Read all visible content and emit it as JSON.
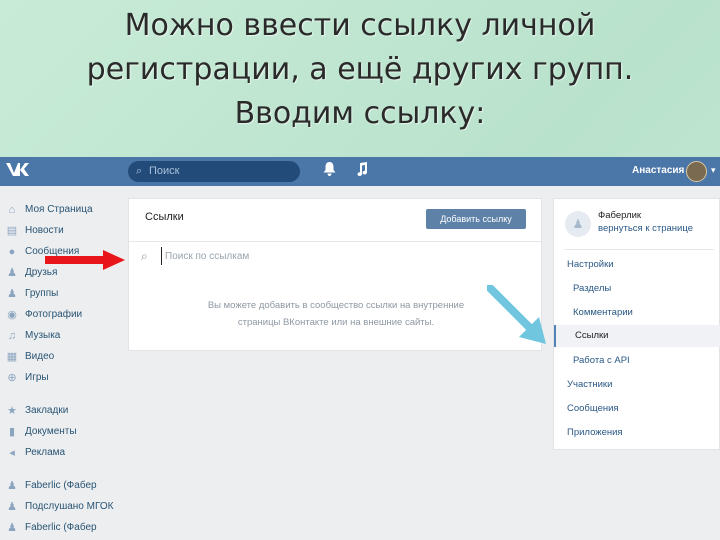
{
  "slide": {
    "title_line1": "Можно ввести ссылку личной",
    "title_line2": "регистрации, а ещё других групп.",
    "title_line3": "Вводим ссылку:"
  },
  "colors": {
    "vk_blue": "#4a76a8",
    "arrow_red": "#e8161b",
    "arrow_cyan": "#6fc6de"
  },
  "topbar": {
    "logo": "VK",
    "search_placeholder": "Поиск",
    "username": "Анастасия",
    "icons": [
      "bell-icon",
      "music-icon"
    ]
  },
  "sidebar": {
    "items": [
      {
        "label": "Моя Страница",
        "icon": "home-icon"
      },
      {
        "label": "Новости",
        "icon": "news-icon"
      },
      {
        "label": "Сообщения",
        "icon": "messages-icon"
      },
      {
        "label": "Друзья",
        "icon": "person-icon"
      },
      {
        "label": "Группы",
        "icon": "groups-icon"
      },
      {
        "label": "Фотографии",
        "icon": "camera-icon"
      },
      {
        "label": "Музыка",
        "icon": "music-icon"
      },
      {
        "label": "Видео",
        "icon": "video-icon"
      },
      {
        "label": "Игры",
        "icon": "gamepad-icon"
      },
      {
        "label": "Закладки",
        "icon": "star-icon"
      },
      {
        "label": "Документы",
        "icon": "document-icon"
      },
      {
        "label": "Реклама",
        "icon": "ads-icon"
      },
      {
        "label": "Faberlic (Фабер",
        "icon": "groups-icon"
      },
      {
        "label": "Подслушано МГОК",
        "icon": "groups-icon"
      },
      {
        "label": "Faberlic (Фабер",
        "icon": "groups-icon"
      }
    ]
  },
  "main": {
    "title": "Ссылки",
    "add_button": "Добавить ссылку",
    "search_placeholder": "Поиск по ссылкам",
    "empty_text_line1": "Вы можете добавить в сообщество ссылки на внутренние",
    "empty_text_line2": "страницы ВКонтакте или на внешние сайты."
  },
  "panel": {
    "group_name": "Фаберлик",
    "back_link": "вернуться к странице",
    "settings": "Настройки",
    "sections": "Разделы",
    "comments": "Комментарии",
    "links": "Ссылки",
    "api": "Работа с API",
    "members": "Участники",
    "messages": "Сообщения",
    "apps": "Приложения"
  }
}
